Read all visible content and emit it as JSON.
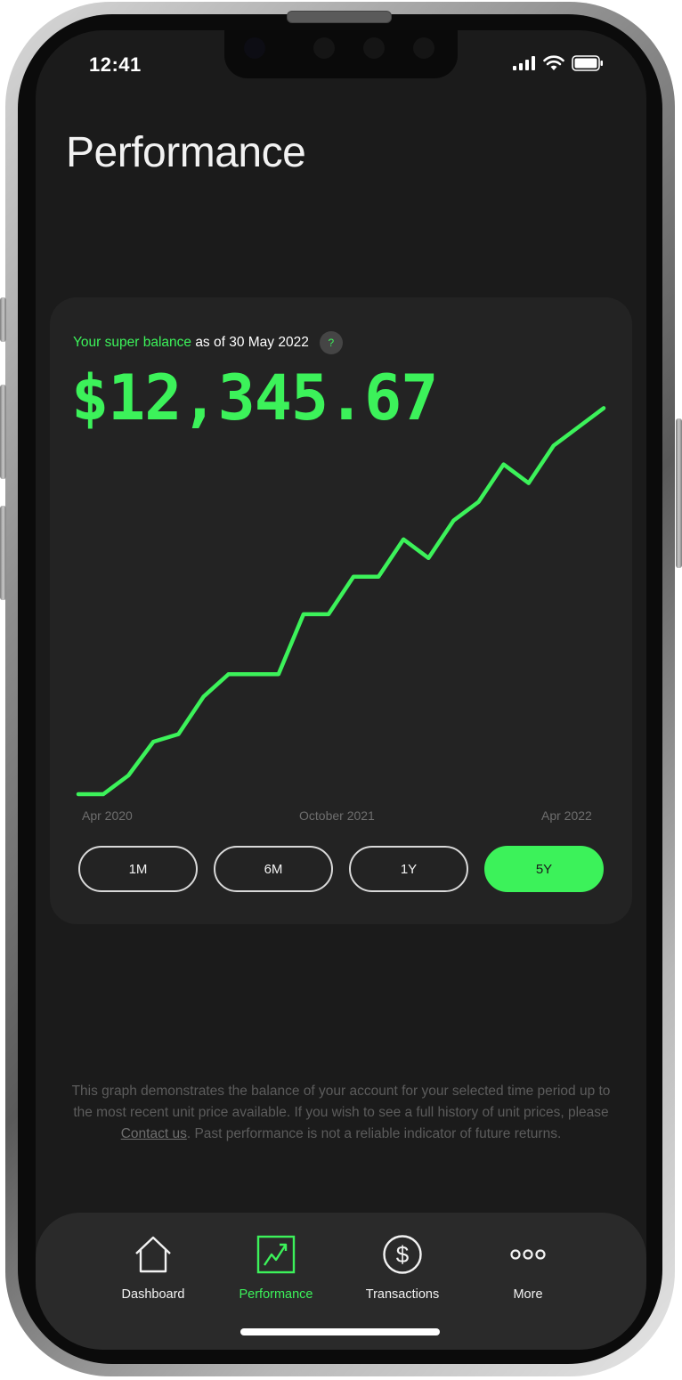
{
  "status_bar": {
    "time": "12:41"
  },
  "header": {
    "title": "Performance"
  },
  "balance": {
    "label_highlight": "Your super balance",
    "label_suffix": "as of 30 May 2022",
    "help_label": "?",
    "amount": "$12,345.67"
  },
  "chart_data": {
    "type": "line",
    "x_labels": [
      "Apr 2020",
      "October 2021",
      "Apr 2022"
    ],
    "series": [
      {
        "values": [
          0,
          0,
          5,
          14,
          16,
          26,
          32,
          32,
          32,
          48,
          48,
          58,
          58,
          68,
          63,
          73,
          78,
          88,
          83,
          93,
          98,
          103
        ]
      }
    ],
    "ylim": [
      0,
      105
    ],
    "color": "#3cf25a",
    "grid": false
  },
  "range_selector": {
    "options": [
      "1M",
      "6M",
      "1Y",
      "5Y"
    ],
    "selected": "5Y"
  },
  "disclaimer": {
    "text_before": "This graph demonstrates the balance of your account for your selected time period up to the most recent unit price available. If you wish to see a full history of unit prices, please ",
    "link_label": "Contact us",
    "text_after": ". Past performance is not a reliable indicator of future returns."
  },
  "tab_bar": {
    "items": [
      {
        "label": "Dashboard",
        "icon": "home-icon"
      },
      {
        "label": "Performance",
        "icon": "trend-chart-icon"
      },
      {
        "label": "Transactions",
        "icon": "dollar-icon"
      },
      {
        "label": "More",
        "icon": "more-dots-icon"
      }
    ],
    "active": "Performance"
  },
  "colors": {
    "accent": "#3cf25a",
    "background": "#1b1b1b",
    "card": "#232323"
  }
}
